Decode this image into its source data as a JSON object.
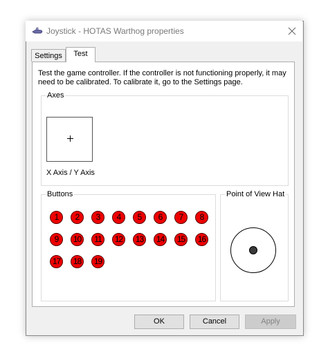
{
  "window": {
    "title": "Joystick - HOTAS Warthog properties",
    "icon": "joystick-icon",
    "close_icon": "close-icon"
  },
  "tabs": [
    {
      "label": "Settings",
      "selected": false
    },
    {
      "label": "Test",
      "selected": true
    }
  ],
  "test_panel": {
    "description": "Test the game controller.  If the controller is not functioning properly, it may need to be calibrated.  To calibrate it, go to the Settings page.",
    "axes": {
      "group_label": "Axes",
      "axis_label": "X Axis / Y Axis"
    },
    "buttons": {
      "group_label": "Buttons",
      "items": [
        "1",
        "2",
        "3",
        "4",
        "5",
        "6",
        "7",
        "8",
        "9",
        "10",
        "11",
        "12",
        "13",
        "14",
        "15",
        "16",
        "17",
        "18",
        "19"
      ],
      "pressed_color": "#ee0000"
    },
    "pov": {
      "group_label": "Point of View Hat"
    }
  },
  "footer": {
    "ok_label": "OK",
    "cancel_label": "Cancel",
    "apply_label": "Apply"
  }
}
